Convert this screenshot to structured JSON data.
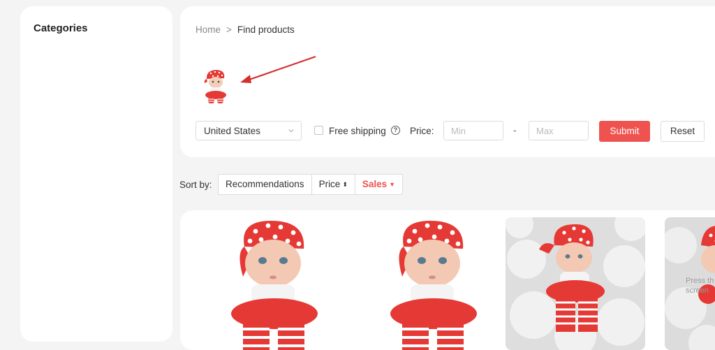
{
  "sidebar": {
    "title": "Categories"
  },
  "breadcrumb": {
    "home": "Home",
    "separator": ">",
    "current": "Find products"
  },
  "search_image": {
    "icon": "doll-thumbnail",
    "annotation": "red-arrow"
  },
  "filters": {
    "country": "United States",
    "free_shipping_label": "Free shipping",
    "free_shipping_checked": false,
    "help_glyph": "?",
    "price_label": "Price:",
    "min_placeholder": "Min",
    "max_placeholder": "Max",
    "range_separator": "-",
    "submit_label": "Submit",
    "reset_label": "Reset"
  },
  "sort": {
    "label": "Sort by:",
    "options": [
      {
        "label": "Recommendations",
        "icon": ""
      },
      {
        "label": "Price",
        "icon": "⬍"
      },
      {
        "label": "Sales",
        "icon": "▼",
        "active": true
      }
    ]
  },
  "products": {
    "items": [
      {
        "image": "baby-doll-red-hat"
      },
      {
        "image": "baby-doll-red-hat"
      },
      {
        "image": "baby-doll-on-fur"
      },
      {
        "image": "baby-doll-partial",
        "overlay_line1": "Press th",
        "overlay_line2": "screen"
      }
    ]
  },
  "colors": {
    "accent": "#ef5350",
    "background": "#f4f4f4",
    "panel": "#ffffff"
  }
}
